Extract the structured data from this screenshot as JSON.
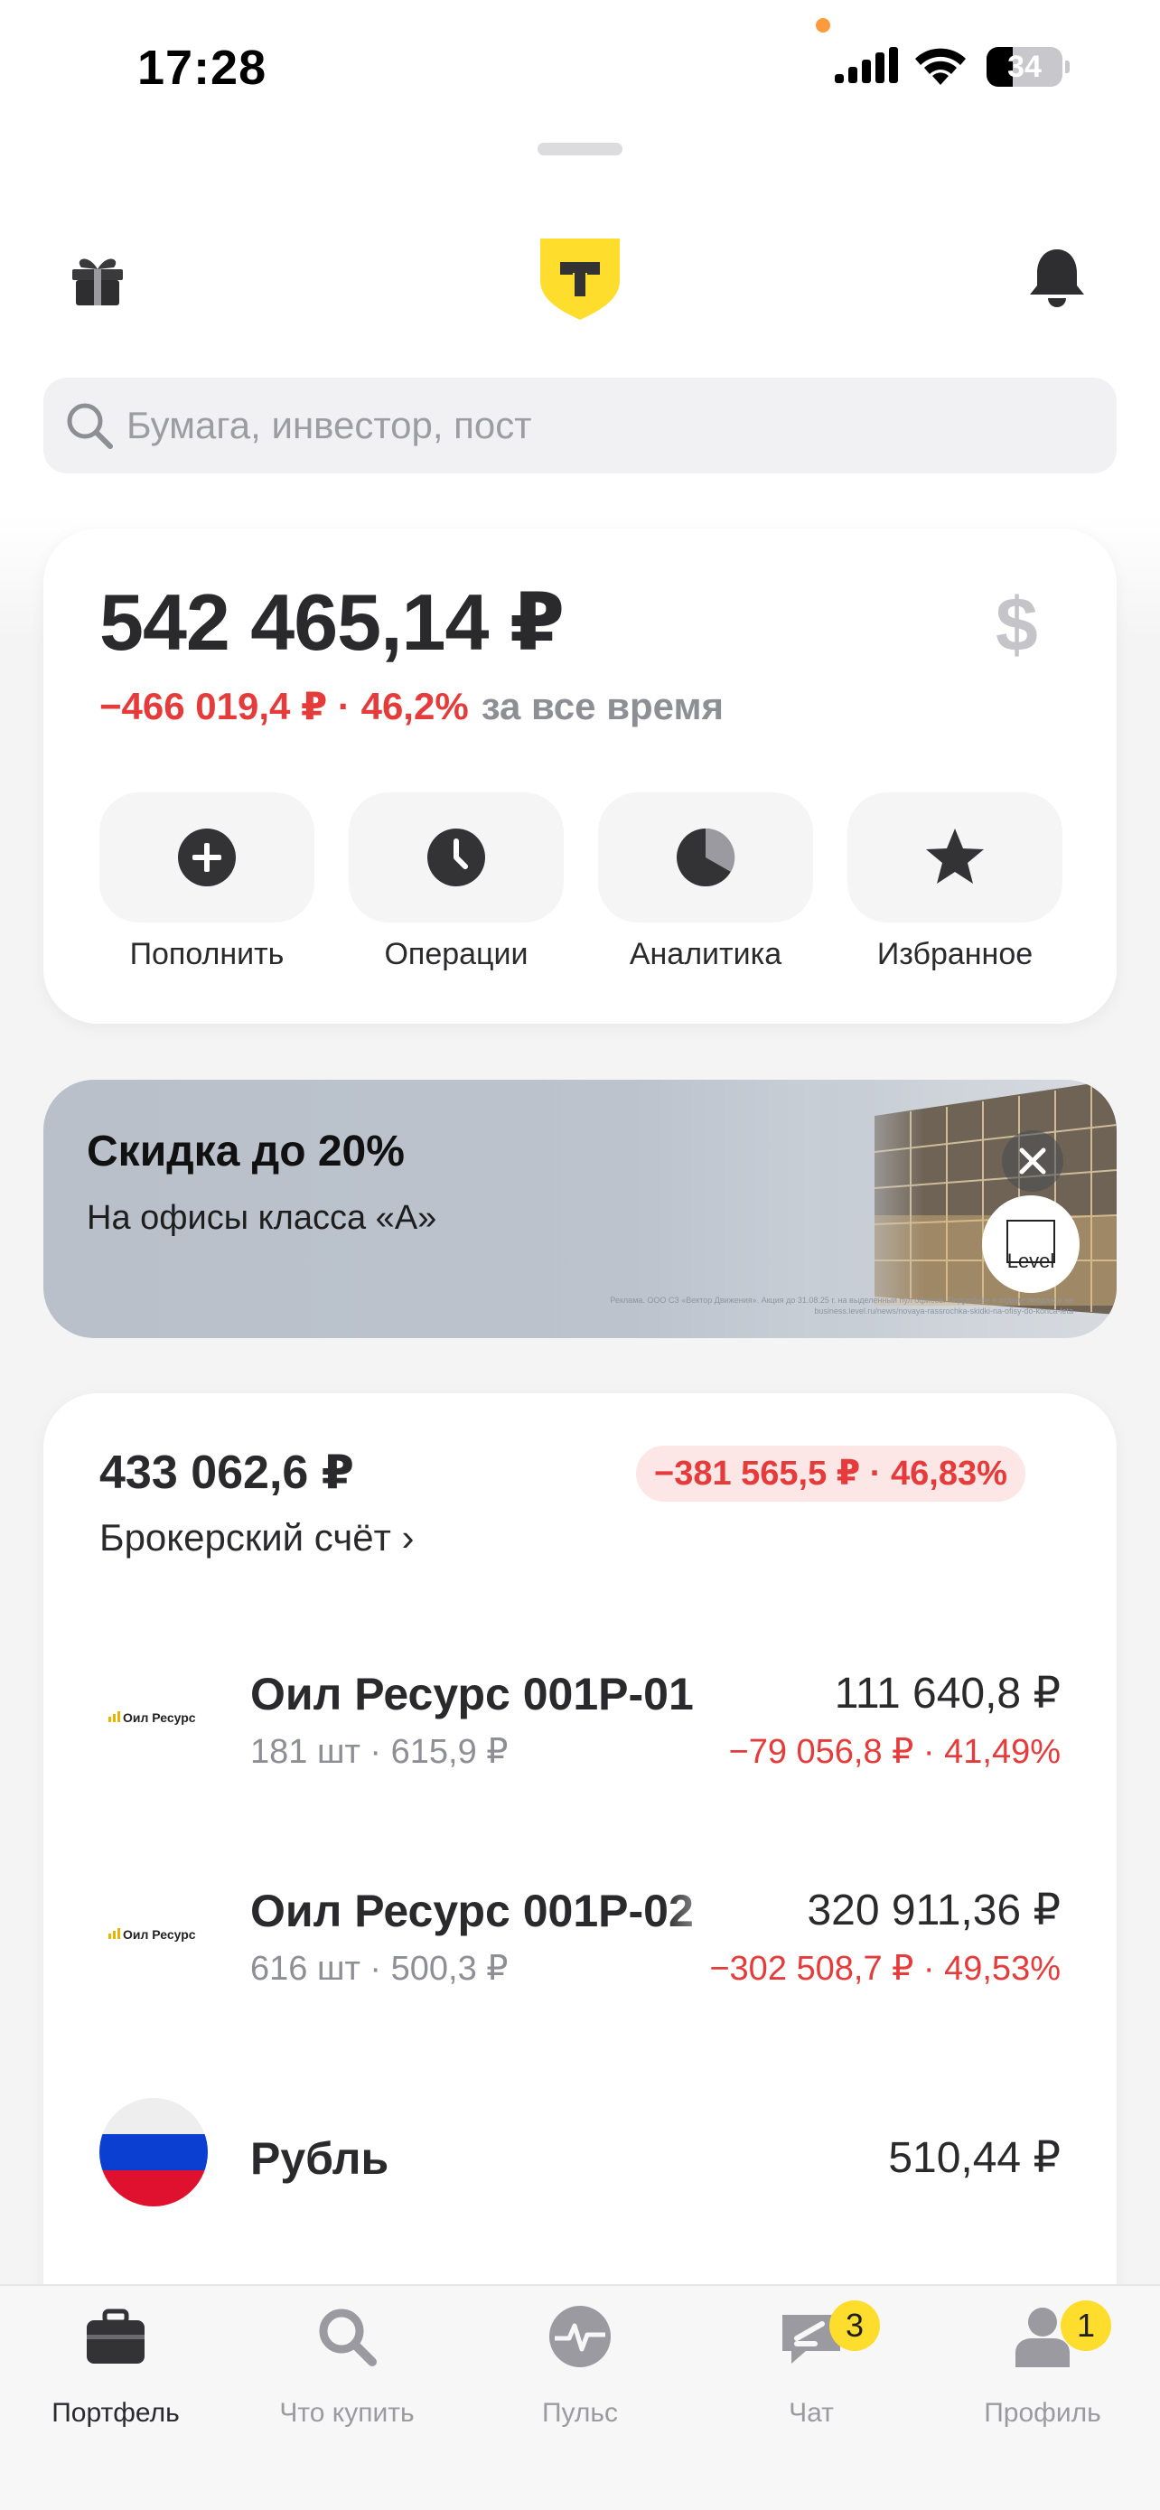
{
  "status_bar": {
    "time": "17:28",
    "battery": "34",
    "battery_level": 0.34
  },
  "search": {
    "placeholder": "Бумага, инвестор, пост"
  },
  "summary": {
    "total": "542 465,14 ₽",
    "currency_symbol": "$",
    "change": "−466 019,4 ₽ · 46,2%",
    "period": "за все время",
    "actions": [
      {
        "label": "Пополнить",
        "icon": "plus-circle-icon"
      },
      {
        "label": "Операции",
        "icon": "clock-icon"
      },
      {
        "label": "Аналитика",
        "icon": "pie-chart-icon"
      },
      {
        "label": "Избранное",
        "icon": "star-icon"
      }
    ]
  },
  "banner": {
    "title": "Скидка до 20%",
    "subtitle": "На офисы класса «А»",
    "logo_text": "Level",
    "fine_print": "Реклама. ООО СЗ «Вектор Движения». Акция до 31.08.25 г. на выделенный пул офисов. Подробнее в отделе продаж и на business.level.ru/news/novaya-rassrochka-skidki-na-ofisy-do-konca-leta"
  },
  "account": {
    "total": "433 062,6 ₽",
    "change": "−381 565,5 ₽ · 46,83%",
    "link": "Брокерский счёт ›",
    "positions": [
      {
        "name": "Оил Ресурс 001P-01",
        "logo_text": "Оил Ресурс",
        "meta": "181 шт · 615,9 ₽",
        "value": "111 640,8 ₽",
        "change": "−79 056,8 ₽ · 41,49%"
      },
      {
        "name": "Оил Ресурс 001P-02",
        "logo_text": "Оил Ресурс",
        "meta": "616 шт · 500,3 ₽",
        "value": "320 911,36 ₽",
        "change": "−302 508,7 ₽ · 49,53%"
      },
      {
        "name": "Рубль",
        "meta": "",
        "value": "510,44 ₽",
        "change": ""
      }
    ]
  },
  "tabbar": {
    "tabs": [
      {
        "label": "Портфель",
        "icon": "briefcase-icon",
        "active": true
      },
      {
        "label": "Что купить",
        "icon": "search-icon"
      },
      {
        "label": "Пульс",
        "icon": "pulse-icon"
      },
      {
        "label": "Чат",
        "icon": "chat-icon",
        "badge": "3"
      },
      {
        "label": "Профиль",
        "icon": "profile-icon",
        "badge": "1"
      }
    ]
  },
  "colors": {
    "accent": "#ffdd2d",
    "negative": "#e53b3b",
    "negative_bg": "#fde6e6",
    "muted": "#8e8e95"
  }
}
